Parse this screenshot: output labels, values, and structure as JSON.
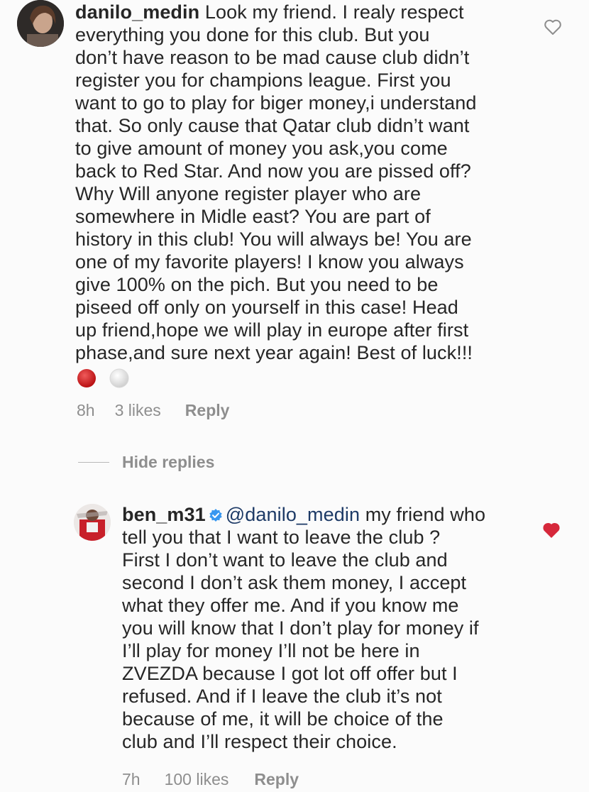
{
  "comments": [
    {
      "username": "danilo_medin",
      "lines": [
        "Look my friend. I realy respect",
        "everything you done for this club. But you",
        "don’t have reason to be mad cause club didn’t",
        "register you for champions league. First you",
        "want to go to play for biger money,i understand",
        "that. So only cause that Qatar club didn’t want",
        "to give amount of money you ask,you come",
        "back to Red Star. And now you are pissed off?",
        "Why Will anyone register player who are",
        "somewhere in Midle east? You are part of",
        "history in this club! You will always be! You are",
        "one of my favorite players! I know you always",
        "give 100% on the pich. But you need to be",
        "piseed off only on yourself in this case! Head",
        "up friend,hope we will play in europe after first",
        "phase,and sure next year again! Best of luck!!!"
      ],
      "emojis": [
        "red-circle",
        "white-circle"
      ],
      "time": "8h",
      "likes": "3 likes",
      "reply_label": "Reply",
      "liked": false
    }
  ],
  "hide_replies_label": "Hide replies",
  "reply": {
    "username": "ben_m31",
    "verified": true,
    "mention": "@danilo_medin",
    "first_line_rest": " my friend who",
    "lines": [
      "tell you that I want to leave the club ?",
      "First I don’t want to leave the club and",
      "second I don’t ask them money, I accept",
      "what they offer me. And if you know me",
      "you will know that I don’t play for money if",
      "I’ll play for money I’ll not be here in",
      "ZVEZDA because I got lot off offer but I",
      "refused. And if I leave the club it’s not",
      "because of me, it will be choice of the",
      "club and I’ll respect their choice."
    ],
    "time": "7h",
    "likes": "100 likes",
    "reply_label": "Reply",
    "liked": true
  },
  "colors": {
    "text": "#262626",
    "meta": "#8e8e8e",
    "heart_liked": "#d6283b",
    "heart_outline": "#8e8e8e",
    "verified": "#3897f0"
  }
}
